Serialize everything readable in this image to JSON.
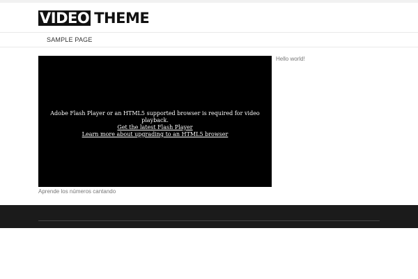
{
  "site": {
    "logo_box": "VIDEO",
    "logo_text": "THEME"
  },
  "nav": {
    "items": [
      {
        "label": "SAMPLE PAGE"
      }
    ]
  },
  "video": {
    "message": "Adobe Flash Player or an HTML5 supported browser is required for video playback.",
    "link1": "Get the latest Flash Player",
    "link2": "Learn more about upgrading to an HTML5 browser",
    "caption": "Aprende los números cantando"
  },
  "sidebar": {
    "post_link": "Hello world!"
  },
  "colors": {
    "footer_bg": "#1b1b1b",
    "video_bg": "#000000"
  }
}
